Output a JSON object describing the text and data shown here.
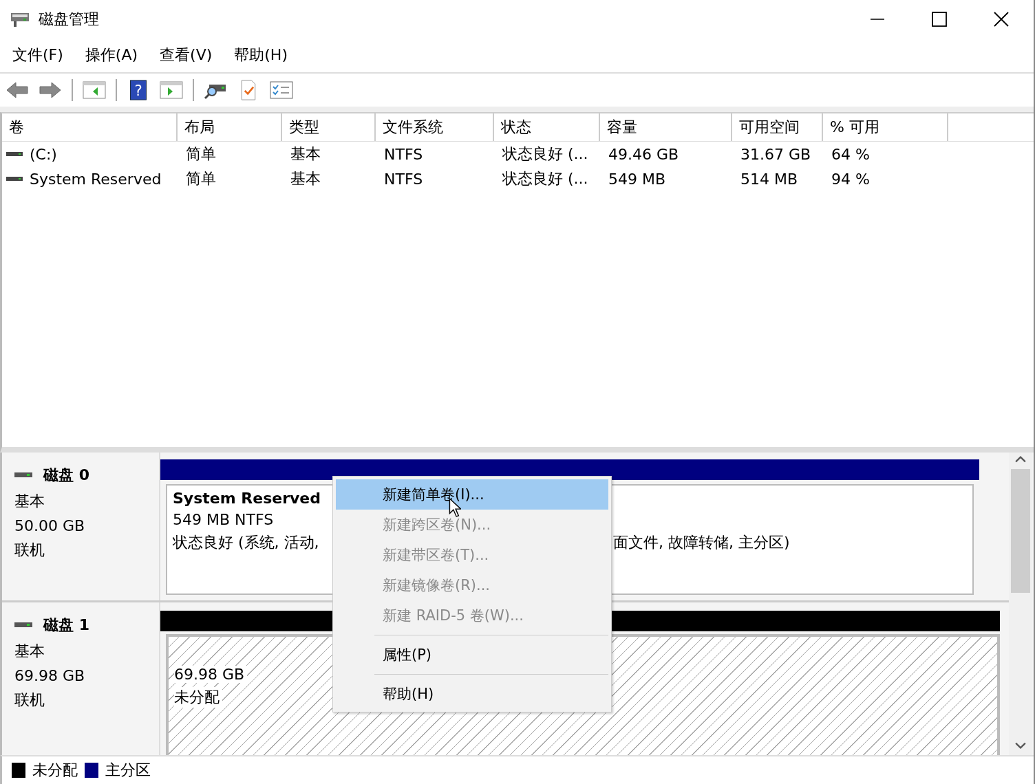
{
  "window": {
    "title": "磁盘管理"
  },
  "toolbar": {
    "help_glyph": "?"
  },
  "menu_bar": [
    "文件(F)",
    "操作(A)",
    "查看(V)",
    "帮助(H)"
  ],
  "table": {
    "columns": [
      "卷",
      "布局",
      "类型",
      "文件系统",
      "状态",
      "容量",
      "可用空间",
      "% 可用"
    ],
    "rows": [
      [
        "(C:)",
        "简单",
        "基本",
        "NTFS",
        "状态良好 (...",
        "49.46 GB",
        "31.67 GB",
        "64 %"
      ],
      [
        "System Reserved",
        "简单",
        "基本",
        "NTFS",
        "状态良好 (...",
        "549 MB",
        "514 MB",
        "94 %"
      ]
    ]
  },
  "disks": [
    {
      "name": "磁盘 0",
      "type": "基本",
      "size": "50.00 GB",
      "status": "联机",
      "partition": {
        "kind": "primary",
        "name": "System Reserved",
        "info": "549 MB NTFS",
        "status_left": "状态良好 (系统, 活动,",
        "status_right": "面文件, 故障转储, 主分区)"
      }
    },
    {
      "name": "磁盘 1",
      "type": "基本",
      "size": "69.98 GB",
      "status": "联机",
      "partition": {
        "kind": "unallocated",
        "info": "69.98 GB",
        "label": "未分配"
      }
    }
  ],
  "legend": [
    {
      "label": "未分配",
      "color": "#000000"
    },
    {
      "label": "主分区",
      "color": "#000080"
    }
  ],
  "context_menu": [
    {
      "kind": "item",
      "label": "新建简单卷(I)...",
      "selected": true,
      "disabled": false
    },
    {
      "kind": "item",
      "label": "新建跨区卷(N)...",
      "selected": false,
      "disabled": true
    },
    {
      "kind": "item",
      "label": "新建带区卷(T)...",
      "selected": false,
      "disabled": true
    },
    {
      "kind": "item",
      "label": "新建镜像卷(R)...",
      "selected": false,
      "disabled": true
    },
    {
      "kind": "item",
      "label": "新建 RAID-5 卷(W)...",
      "selected": false,
      "disabled": true
    },
    {
      "kind": "separator"
    },
    {
      "kind": "item",
      "label": "属性(P)",
      "selected": false,
      "disabled": false
    },
    {
      "kind": "separator"
    },
    {
      "kind": "item",
      "label": "帮助(H)",
      "selected": false,
      "disabled": false
    }
  ]
}
